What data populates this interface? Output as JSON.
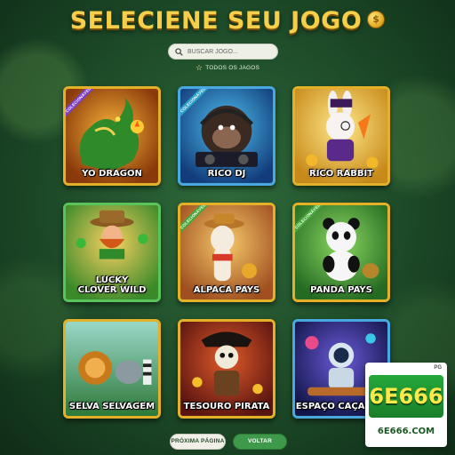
{
  "header": {
    "title": "SELECIENE SEU JOGO"
  },
  "search": {
    "placeholder": "BUSCAR JOGO..."
  },
  "filter": {
    "label": "TODOS OS JAGOS"
  },
  "ribbon_text": "COLECIONÁVEL",
  "games": [
    {
      "name": "YO DRAGON",
      "frame": "gold",
      "ribbon": true
    },
    {
      "name": "RICO DJ",
      "frame": "blue",
      "ribbon": true
    },
    {
      "name": "RICO RABBIT",
      "frame": "gold",
      "ribbon": false
    },
    {
      "name_line1": "LUCKY",
      "name_line2": "CLOVER WILD",
      "frame": "green",
      "ribbon": false
    },
    {
      "name": "ALPACA PAYS",
      "frame": "gold",
      "ribbon": true
    },
    {
      "name": "PANDA PAYS",
      "frame": "gold",
      "ribbon": true
    },
    {
      "name": "SELVA SELVAGEM",
      "frame": "gold",
      "ribbon": false
    },
    {
      "name": "TESOURO PIRATA",
      "frame": "gold",
      "ribbon": false
    },
    {
      "name": "ESPAÇO CAÇA-NÍQ",
      "frame": "blue",
      "ribbon": false
    }
  ],
  "footer": {
    "next_label": "PRÓXIMA PÁGINA",
    "back_label": "VOLTAR"
  },
  "brand": {
    "logo": "6E666",
    "url": "6E666.COM",
    "badge": "PG"
  },
  "colors": {
    "accent_gold": "#f6cf4a",
    "button_green": "#3e9a4a",
    "frame_gold": "#e3b028",
    "frame_blue": "#4aa8e0",
    "frame_green": "#58c45a"
  },
  "icons": {
    "title_icon": "coin-icon",
    "search": "search-icon",
    "filter": "star-icon"
  }
}
